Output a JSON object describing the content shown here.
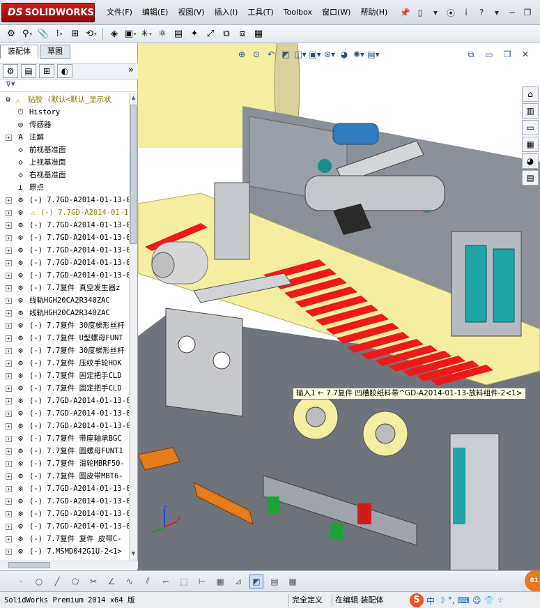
{
  "app": {
    "logo_text": "SOLIDWORKS",
    "logo_prefix": "DS"
  },
  "menu": {
    "items": [
      "文件(F)",
      "编辑(E)",
      "视图(V)",
      "插入(I)",
      "工具(T)",
      "Toolbox",
      "窗口(W)",
      "帮助(H)"
    ]
  },
  "panel": {
    "tabs": [
      "装配体",
      "草图"
    ],
    "active_tab": "装配体",
    "more_label": "»"
  },
  "tree": {
    "root_label": "贴胶  (默认<默认_显示状",
    "items": [
      {
        "label": "History",
        "icon": "history-icon",
        "kind": "feature"
      },
      {
        "label": "传感器",
        "icon": "sensor-icon",
        "kind": "feature"
      },
      {
        "label": "注解",
        "icon": "annotation-icon",
        "kind": "feature",
        "expandable": true
      },
      {
        "label": "前视基准面",
        "icon": "plane-icon",
        "kind": "feature"
      },
      {
        "label": "上视基准面",
        "icon": "plane-icon",
        "kind": "feature"
      },
      {
        "label": "右视基准面",
        "icon": "plane-icon",
        "kind": "feature"
      },
      {
        "label": "原点",
        "icon": "origin-icon",
        "kind": "feature"
      },
      {
        "label": "(-) 7.7GD-A2014-01-13-0",
        "icon": "subassembly-icon",
        "kind": "component"
      },
      {
        "label": "(-) 7.7GD-A2014-01-1",
        "icon": "subassembly-icon",
        "kind": "component",
        "warning": true
      },
      {
        "label": "(-) 7.7GD-A2014-01-13-0",
        "icon": "subassembly-icon",
        "kind": "component"
      },
      {
        "label": "(-) 7.7GD-A2014-01-13-0",
        "icon": "subassembly-icon",
        "kind": "component"
      },
      {
        "label": "(-) 7.7GD-A2014-01-13-0",
        "icon": "subassembly-icon",
        "kind": "component"
      },
      {
        "label": "(-) 7.7GD-A2014-01-13-0",
        "icon": "subassembly-icon",
        "kind": "component"
      },
      {
        "label": "(-) 7.7GD-A2014-01-13-0",
        "icon": "subassembly-icon",
        "kind": "component"
      },
      {
        "label": "(-) 7.7复件 真空发生器z",
        "icon": "subassembly-icon",
        "kind": "component"
      },
      {
        "label": "线轨HGH20CA2R340ZAC",
        "icon": "subassembly-icon",
        "kind": "component"
      },
      {
        "label": "线轨HGH20CA2R340ZAC",
        "icon": "subassembly-icon",
        "kind": "component"
      },
      {
        "label": "(-) 7.7复件 30度梯形丝杆",
        "icon": "subassembly-icon",
        "kind": "component"
      },
      {
        "label": "(-) 7.7复件 U型螺母FUNT",
        "icon": "subassembly-icon",
        "kind": "component"
      },
      {
        "label": "(-) 7.7复件 30度梯形丝杆",
        "icon": "subassembly-icon",
        "kind": "component"
      },
      {
        "label": "(-) 7.7复件 压纹手轮HOK",
        "icon": "subassembly-icon",
        "kind": "component"
      },
      {
        "label": "(-) 7.7复件 固定把手CLD",
        "icon": "subassembly-icon",
        "kind": "component"
      },
      {
        "label": "(-) 7.7复件 固定把手CLD",
        "icon": "subassembly-icon",
        "kind": "component"
      },
      {
        "label": "(-) 7.7GD-A2014-01-13-0",
        "icon": "subassembly-icon",
        "kind": "component"
      },
      {
        "label": "(-) 7.7GD-A2014-01-13-0",
        "icon": "subassembly-icon",
        "kind": "component"
      },
      {
        "label": "(-) 7.7GD-A2014-01-13-0",
        "icon": "subassembly-icon",
        "kind": "component"
      },
      {
        "label": "(-) 7.7复件 带座轴承BGC",
        "icon": "subassembly-icon",
        "kind": "component"
      },
      {
        "label": "(-) 7.7复件 圆螺母FUNT1",
        "icon": "subassembly-icon",
        "kind": "component"
      },
      {
        "label": "(-) 7.7复件 滑轮MBRF50-",
        "icon": "subassembly-icon",
        "kind": "component"
      },
      {
        "label": "(-) 7.7复件 圆皮带MBT6-",
        "icon": "subassembly-icon",
        "kind": "component"
      },
      {
        "label": "(-) 7.7GD-A2014-01-13-0",
        "icon": "subassembly-icon",
        "kind": "component"
      },
      {
        "label": "(-) 7.7GD-A2014-01-13-0",
        "icon": "subassembly-icon",
        "kind": "component"
      },
      {
        "label": "(-) 7.7GD-A2014-01-13-0",
        "icon": "subassembly-icon",
        "kind": "component"
      },
      {
        "label": "(-) 7.7GD-A2014-01-13-0",
        "icon": "subassembly-icon",
        "kind": "component"
      },
      {
        "label": "(-) 7.7复件 复件 皮带C-",
        "icon": "subassembly-icon",
        "kind": "component"
      },
      {
        "label": "(-) 7.MSMD042G1U-2<1>",
        "icon": "subassembly-icon",
        "kind": "component"
      }
    ]
  },
  "viewport": {
    "tooltip": "输入1 ← 7.7复件 凹槽胶纸料带^GD-A2014-01-13-放料组件-2<1>",
    "triad_labels": {
      "x": "X",
      "y": "Y",
      "z": "Z"
    }
  },
  "status": {
    "product": "SolidWorks Premium 2014 x64 版",
    "definition": "完全定义",
    "mode": "在编辑 装配体",
    "ime_label": "中",
    "badge": "81"
  },
  "colors": {
    "logo_red": "#c41616",
    "tape_yellow": "#f3eea0",
    "label_red": "#ee1a1a",
    "machine_gray": "#8a8f98",
    "accent_teal": "#1ea5a8"
  }
}
